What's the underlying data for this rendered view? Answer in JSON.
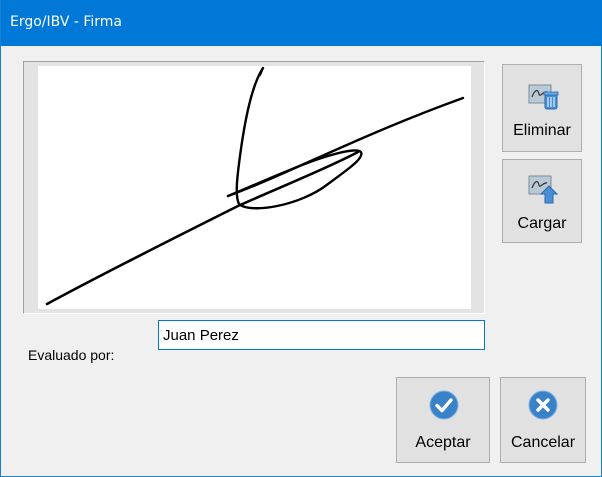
{
  "window": {
    "title": "Ergo/IBV - Firma"
  },
  "signature": {
    "has_signature": true,
    "ink_color": "#000000"
  },
  "buttons": {
    "eliminar_label": "Eliminar",
    "eliminar_icon": "signature-delete-icon",
    "cargar_label": "Cargar",
    "cargar_icon": "signature-upload-icon",
    "aceptar_label": "Aceptar",
    "aceptar_icon": "check-circle-icon",
    "cancelar_label": "Cancelar",
    "cancelar_icon": "close-circle-icon"
  },
  "form": {
    "evaluado_label": "Evaluado por:",
    "evaluado_value": "Juan Perez"
  },
  "colors": {
    "titlebar": "#0078d7",
    "dialog_bg": "#f0f0f0",
    "button_bg": "#e1e1e1",
    "accent_icon": "#3a82c8"
  }
}
